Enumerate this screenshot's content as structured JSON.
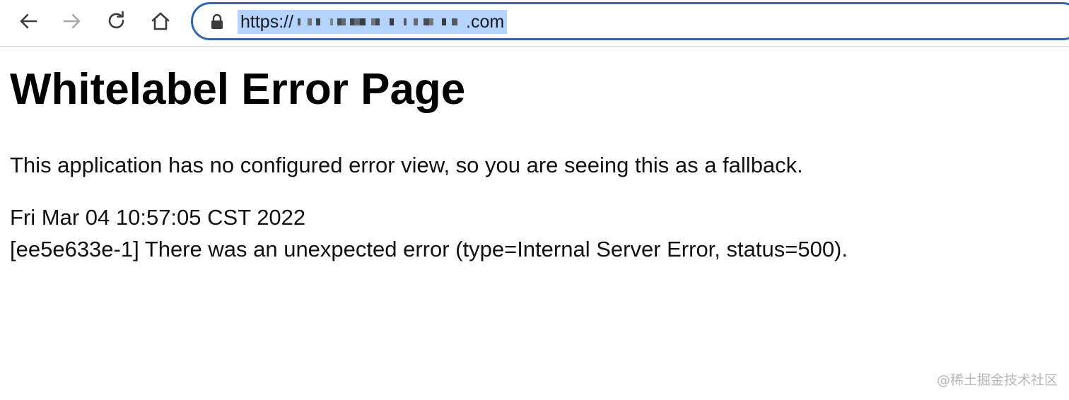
{
  "browser": {
    "url_prefix": "https://",
    "url_suffix": ".com"
  },
  "page": {
    "title": "Whitelabel Error Page",
    "intro": "This application has no configured error view, so you are seeing this as a fallback.",
    "timestamp": "Fri Mar 04 10:57:05 CST 2022",
    "error": "[ee5e633e-1] There was an unexpected error (type=Internal Server Error, status=500)."
  },
  "watermark": {
    "text": "@稀土掘金技术社区"
  },
  "icons": {
    "back": "back-arrow-icon",
    "forward": "forward-arrow-icon",
    "reload": "reload-icon",
    "home": "home-icon",
    "lock": "lock-icon"
  },
  "colors": {
    "omnibox_border": "#2f66b3",
    "url_selection": "#b4d3ff",
    "watermark": "#b8b8b8"
  }
}
